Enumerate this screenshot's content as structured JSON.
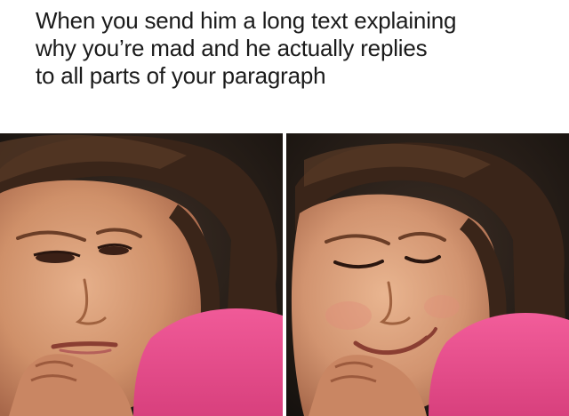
{
  "meme": {
    "caption": "When you send him a long text explaining\nwhy you’re mad and he actually replies\nto all parts of your paragraph",
    "panels": [
      {
        "expression": "unimpressed"
      },
      {
        "expression": "smirking"
      }
    ]
  }
}
